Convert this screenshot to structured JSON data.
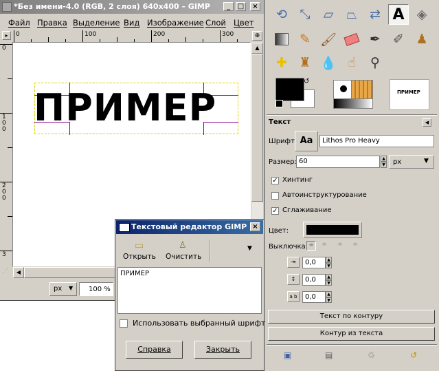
{
  "image_window": {
    "title": "*Без имени-4.0 (RGB, 2 слоя) 640x400 – GIMP",
    "menu": [
      "Файл",
      "Правка",
      "Выделение",
      "Вид",
      "Изображение",
      "Слой",
      "Цвет"
    ],
    "ruler_h_labels": [
      "0",
      "100",
      "200",
      "300"
    ],
    "ruler_v_labels": [
      "0",
      "1\n0\n0",
      "2\n0\n0",
      "3"
    ],
    "canvas_text": "ПРИМЕР",
    "unit": "px",
    "zoom": "100 %"
  },
  "toolbox": {
    "section_title": "Текст",
    "font_label": "Шрифт:",
    "font_preview": "Aa",
    "font_value": "Lithos Pro Heavy",
    "size_label": "Размер:",
    "size_value": "60",
    "size_unit": "px",
    "hinting_label": "Хинтинг",
    "hinting_checked": true,
    "autohint_label": "Автоинструктурование",
    "autohint_checked": false,
    "antialias_label": "Сглаживание",
    "antialias_checked": true,
    "color_label": "Цвет:",
    "color_value": "#000000",
    "justify_label": "Выключка:",
    "indent_value": "0,0",
    "line_spacing_value": "0,0",
    "letter_spacing_value": "0,0",
    "text_along_path_button": "Текст по контуру",
    "path_from_text_button": "Контур из текста",
    "pattern_preview_text": "ПРИМЕР"
  },
  "text_editor": {
    "title": "Текстовый редактор GIMP",
    "open_label": "Открыть",
    "clear_label": "Очистить",
    "content": "ПРИМЕР",
    "use_font_label": "Использовать выбранный шрифт",
    "use_font_checked": false,
    "help_button": "Справка",
    "close_button": "Закрыть"
  }
}
